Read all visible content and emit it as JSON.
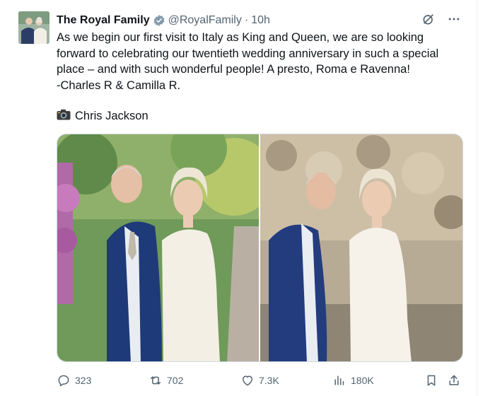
{
  "tweet": {
    "display_name": "The Royal Family",
    "handle": "@RoyalFamily",
    "separator": "·",
    "time": "10h",
    "text_lines": [
      "As we begin our first visit to Italy as King and Queen, we are so looking",
      "forward to celebrating our twentieth wedding anniversary in such a special",
      "place – and with such wonderful people! A presto, Roma e Ravenna!",
      "-Charles R & Camilla R."
    ],
    "photo_credit_icon": "camera-icon",
    "photo_credit": "Chris Jackson"
  },
  "metrics": {
    "replies": "323",
    "reposts": "702",
    "likes": "7.3K",
    "views": "180K"
  },
  "colors": {
    "verified": "#829aab",
    "muted": "#536471",
    "text": "#0f1419"
  }
}
